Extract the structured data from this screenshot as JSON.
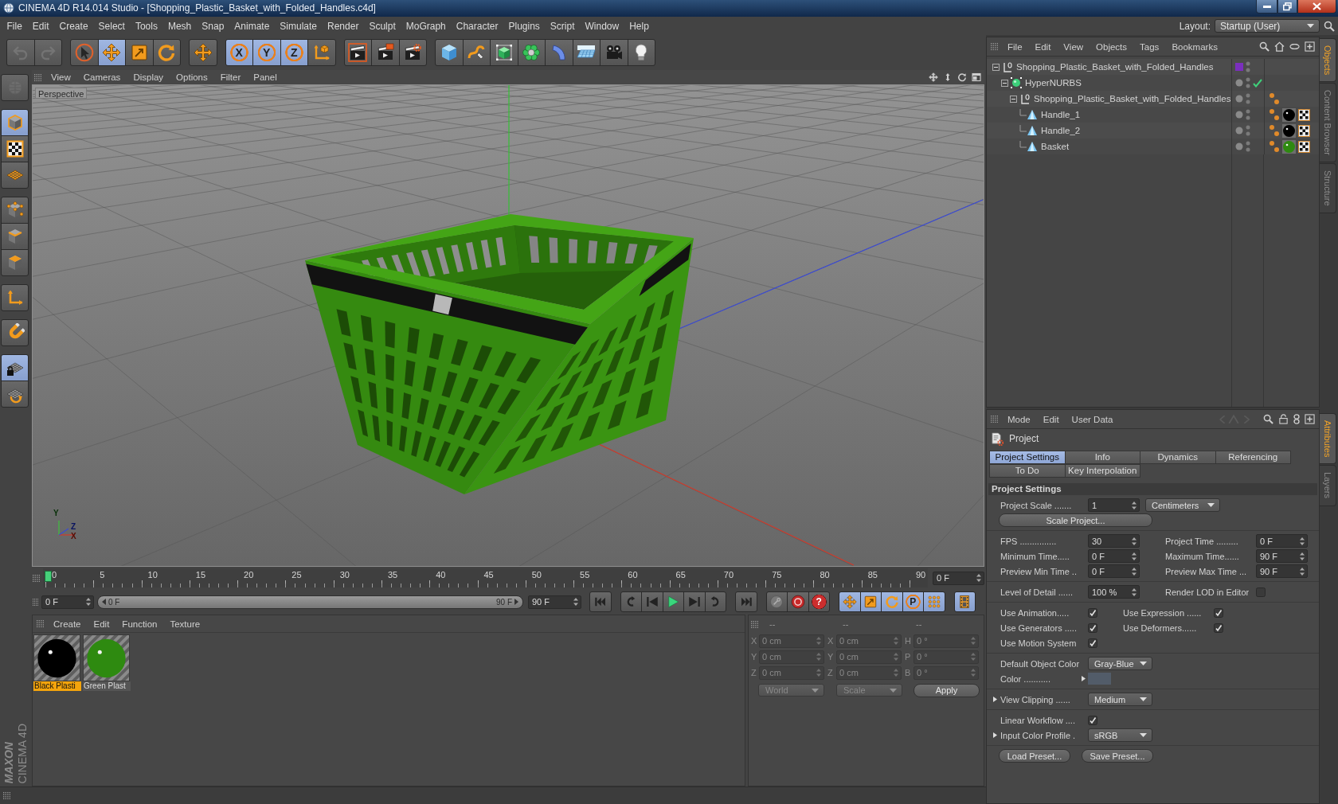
{
  "window": {
    "title": "CINEMA 4D R14.014 Studio - [Shopping_Plastic_Basket_with_Folded_Handles.c4d]"
  },
  "menu_bar": {
    "items": [
      "File",
      "Edit",
      "Create",
      "Select",
      "Tools",
      "Mesh",
      "Snap",
      "Animate",
      "Simulate",
      "Render",
      "Sculpt",
      "MoGraph",
      "Character",
      "Plugins",
      "Script",
      "Window",
      "Help"
    ],
    "layout_label": "Layout:",
    "layout_value": "Startup (User)"
  },
  "toolbar": [
    {
      "items": [
        {
          "kind": "undo",
          "disabled": true
        },
        {
          "kind": "redo",
          "disabled": true
        }
      ]
    },
    {
      "items": [
        {
          "kind": "select",
          "selected": false
        },
        {
          "kind": "move",
          "selected": true
        },
        {
          "kind": "scale",
          "selected": false
        },
        {
          "kind": "rotate",
          "selected": false
        }
      ]
    },
    {
      "items": [
        {
          "kind": "recent",
          "selected": false
        }
      ]
    },
    {
      "items": [
        {
          "kind": "axis",
          "label": "X",
          "selected": true
        },
        {
          "kind": "axis",
          "label": "Y",
          "selected": true
        },
        {
          "kind": "axis",
          "label": "Z",
          "selected": true
        },
        {
          "kind": "coordinates",
          "selected": false
        }
      ]
    },
    {
      "items": [
        {
          "kind": "render-view",
          "selected": false
        },
        {
          "kind": "render-picture",
          "selected": false
        },
        {
          "kind": "render-settings",
          "selected": false
        }
      ]
    },
    {
      "items": [
        {
          "kind": "cube",
          "selected": false
        },
        {
          "kind": "spline",
          "selected": false
        },
        {
          "kind": "subdivision",
          "selected": false
        },
        {
          "kind": "cloner",
          "selected": false
        },
        {
          "kind": "deformer",
          "selected": false
        },
        {
          "kind": "floor",
          "selected": false
        },
        {
          "kind": "camera",
          "selected": false
        },
        {
          "kind": "light",
          "selected": false
        }
      ]
    }
  ],
  "mode_toolbar": [
    {
      "items": [
        {
          "kind": "make-editable",
          "disabled": true
        }
      ]
    },
    {
      "items": [
        {
          "kind": "model",
          "selected": true
        },
        {
          "kind": "texture",
          "selected": false
        },
        {
          "kind": "workplane",
          "selected": false
        }
      ]
    },
    {
      "items": [
        {
          "kind": "points",
          "selected": false
        },
        {
          "kind": "edges",
          "selected": false
        },
        {
          "kind": "polygons",
          "selected": false
        }
      ]
    },
    {
      "items": [
        {
          "kind": "axis-mode",
          "selected": false
        }
      ]
    },
    {
      "items": [
        {
          "kind": "snap",
          "selected": false
        }
      ]
    },
    {
      "items": [
        {
          "kind": "locked-workplane",
          "selected": true
        },
        {
          "kind": "planar-workplane",
          "selected": false
        }
      ]
    }
  ],
  "logo": {
    "company": "MAXON",
    "product": "CINEMA 4D"
  },
  "viewport": {
    "menu": [
      "View",
      "Cameras",
      "Display",
      "Options",
      "Filter",
      "Panel"
    ],
    "camera": "Perspective",
    "axis_labels": [
      "Y",
      "Z",
      "X"
    ]
  },
  "timeline": {
    "ruler_labels": [
      "0",
      "5",
      "10",
      "15",
      "20",
      "25",
      "30",
      "35",
      "40",
      "45",
      "50",
      "55",
      "60",
      "65",
      "70",
      "75",
      "80",
      "85",
      "90"
    ],
    "level": 0,
    "current_frame": "0 F"
  },
  "transport": {
    "start_field": "0 F",
    "range_start": "0 F",
    "range_end": "90 F",
    "end_field": "90 F",
    "groups": [
      {
        "items": [
          {
            "kind": "go-start"
          }
        ]
      },
      {
        "items": [
          {
            "kind": "prev-key"
          },
          {
            "kind": "prev-frame"
          },
          {
            "kind": "play"
          },
          {
            "kind": "next-frame"
          },
          {
            "kind": "next-key"
          }
        ]
      },
      {
        "items": [
          {
            "kind": "go-end"
          }
        ]
      },
      {
        "items": [
          {
            "kind": "key",
            "selected": false
          },
          {
            "kind": "record",
            "selected": false
          },
          {
            "kind": "autokey",
            "label": "?",
            "selected": false
          }
        ]
      },
      {
        "items": [
          {
            "kind": "move",
            "selected": true
          },
          {
            "kind": "scale",
            "selected": true
          },
          {
            "kind": "rotate",
            "selected": true
          },
          {
            "kind": "param",
            "label": "P",
            "selected": true
          },
          {
            "kind": "pla",
            "selected": true
          }
        ]
      },
      {
        "items": [
          {
            "kind": "timeline",
            "selected": true
          }
        ]
      }
    ]
  },
  "materials": {
    "menu": [
      "Create",
      "Edit",
      "Function",
      "Texture"
    ],
    "items": [
      {
        "name": "Black Plasti",
        "color": "#000000",
        "selected": true
      },
      {
        "name": "Green Plast",
        "color": "#2e8a10",
        "selected": false
      }
    ]
  },
  "coordinates": {
    "disabled": true,
    "headers": [
      "--",
      "--",
      "--"
    ],
    "rows": [
      {
        "position_axis": "X",
        "position": "0 cm",
        "size_axis": "X",
        "size": "0 cm",
        "rotation_axis": "H",
        "rotation": "0 °"
      },
      {
        "position_axis": "Y",
        "position": "0 cm",
        "size_axis": "Y",
        "size": "0 cm",
        "rotation_axis": "P",
        "rotation": "0 °"
      },
      {
        "position_axis": "Z",
        "position": "0 cm",
        "size_axis": "Z",
        "size": "0 cm",
        "rotation_axis": "B",
        "rotation": "0 °"
      }
    ],
    "mode": "World",
    "size_mode": "Scale",
    "apply": "Apply"
  },
  "object_manager": {
    "menu": [
      "File",
      "Edit",
      "View",
      "Objects",
      "Tags",
      "Bookmarks"
    ],
    "objects": [
      {
        "name": "Shopping_Plastic_Basket_with_Folded_Handles",
        "kind": "null",
        "color": "#7b2fbe",
        "expanded": true,
        "selected": false,
        "children": [
          {
            "name": "HyperNURBS",
            "kind": "hypernurbs",
            "enabled": true,
            "expanded": true,
            "selected": false,
            "children": [
              {
                "name": "Shopping_Plastic_Basket_with_Folded_Handles",
                "kind": "null",
                "expanded": true,
                "selected": false,
                "tags": [
                  {
                    "kind": "phong"
                  }
                ],
                "children": [
                  {
                    "name": "Handle_1",
                    "kind": "polygon",
                    "selected": false,
                    "tags": [
                      {
                        "kind": "phong"
                      },
                      {
                        "kind": "material",
                        "color": "#000000"
                      },
                      {
                        "kind": "texture"
                      }
                    ]
                  },
                  {
                    "name": "Handle_2",
                    "kind": "polygon",
                    "selected": false,
                    "tags": [
                      {
                        "kind": "phong"
                      },
                      {
                        "kind": "material",
                        "color": "#000000"
                      },
                      {
                        "kind": "texture"
                      }
                    ]
                  },
                  {
                    "name": "Basket",
                    "kind": "polygon",
                    "selected": false,
                    "tags": [
                      {
                        "kind": "phong"
                      },
                      {
                        "kind": "material",
                        "color": "#2e8a10"
                      },
                      {
                        "kind": "texture"
                      }
                    ]
                  }
                ]
              }
            ]
          }
        ]
      }
    ]
  },
  "side_tabs_top": [
    {
      "label": "Objects",
      "selected": true
    },
    {
      "label": "Content Browser",
      "selected": false
    },
    {
      "label": "Structure",
      "selected": false
    }
  ],
  "side_tabs_bottom": [
    {
      "label": "Attributes",
      "selected": true
    },
    {
      "label": "Layers",
      "selected": false
    }
  ],
  "attributes": {
    "menu": [
      "Mode",
      "Edit",
      "User Data"
    ],
    "object": "Project",
    "tabs": [
      [
        {
          "label": "Project Settings",
          "selected": true
        },
        {
          "label": "Info",
          "selected": false
        },
        {
          "label": "Dynamics",
          "selected": false
        },
        {
          "label": "Referencing",
          "selected": false
        }
      ],
      [
        {
          "label": "To Do",
          "selected": false
        },
        {
          "label": "Key Interpolation",
          "selected": false
        }
      ]
    ],
    "section": "Project Settings",
    "groups": [
      [
        [
          {
            "kind": "number",
            "label": "Project Scale .......",
            "value": "1"
          },
          {
            "kind": "dropdown",
            "value": "Centimeters"
          }
        ],
        [
          {
            "kind": "button",
            "label": "Scale Project..."
          }
        ]
      ],
      [
        [
          {
            "kind": "number",
            "label": "FPS ...............",
            "value": "30"
          },
          {
            "kind": "number",
            "label": "Project Time .........",
            "value": "0 F"
          }
        ],
        [
          {
            "kind": "number",
            "label": "Minimum Time.....",
            "value": "0 F"
          },
          {
            "kind": "number",
            "label": "Maximum Time......",
            "value": "90 F"
          }
        ],
        [
          {
            "kind": "number",
            "label": "Preview Min Time ..",
            "value": "0 F"
          },
          {
            "kind": "number",
            "label": "Preview Max Time ...",
            "value": "90 F"
          }
        ]
      ],
      [
        [
          {
            "kind": "number",
            "label": "Level of Detail ......",
            "value": "100 %"
          },
          {
            "kind": "checkbox",
            "label": "Render LOD in Editor",
            "checked": false
          }
        ]
      ],
      [
        [
          {
            "kind": "checkbox",
            "label": "Use Animation.....",
            "checked": true
          },
          {
            "kind": "checkbox",
            "label": "Use Expression ......",
            "checked": true
          }
        ],
        [
          {
            "kind": "checkbox",
            "label": "Use Generators .....",
            "checked": true
          },
          {
            "kind": "checkbox",
            "label": "Use Deformers......",
            "checked": true
          }
        ],
        [
          {
            "kind": "checkbox",
            "label": "Use Motion System",
            "checked": true
          }
        ]
      ],
      [
        [
          {
            "kind": "dropdown",
            "label": "Default Object Color",
            "value": "Gray-Blue"
          }
        ],
        [
          {
            "kind": "color",
            "label": "Color ...........",
            "color": "#525c69",
            "expanded": false
          }
        ]
      ],
      [
        [
          {
            "kind": "dropdown",
            "label": "View Clipping ......",
            "value": "Medium",
            "expanded": false
          }
        ]
      ],
      [
        [
          {
            "kind": "checkbox",
            "label": "Linear Workflow ....",
            "checked": true
          }
        ],
        [
          {
            "kind": "dropdown",
            "label": "Input Color Profile .",
            "value": "sRGB",
            "expanded": false
          }
        ]
      ],
      [
        [
          {
            "kind": "button",
            "label": "Load Preset..."
          },
          {
            "kind": "button",
            "label": "Save Preset..."
          }
        ]
      ]
    ]
  }
}
